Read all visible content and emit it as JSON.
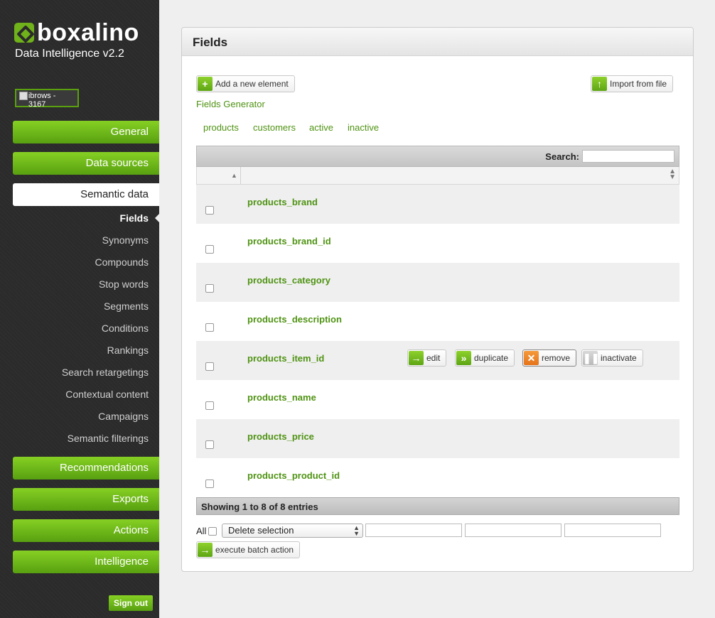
{
  "brand": {
    "name": "boxalino",
    "subtitle": "Data Intelligence v2.2",
    "account": "ibrows - 3167"
  },
  "nav": {
    "general": "General",
    "data_sources": "Data sources",
    "semantic_data": "Semantic data",
    "sub_items": [
      "Fields",
      "Synonyms",
      "Compounds",
      "Stop words",
      "Segments",
      "Conditions",
      "Rankings",
      "Search retargetings",
      "Contextual content",
      "Campaigns",
      "Semantic filterings"
    ],
    "recommendations": "Recommendations",
    "exports": "Exports",
    "actions": "Actions",
    "intelligence": "Intelligence",
    "sign_out": "Sign out"
  },
  "panel": {
    "title": "Fields",
    "add_button": "Add a new element",
    "import_button": "Import from file",
    "generator_link": "Fields Generator",
    "filters": [
      "products",
      "customers",
      "active",
      "inactive"
    ],
    "search_label": "Search:",
    "rows": [
      "products_brand",
      "products_brand_id",
      "products_category",
      "products_description",
      "products_item_id",
      "products_name",
      "products_price",
      "products_product_id"
    ],
    "row_actions": {
      "edit": "edit",
      "duplicate": "duplicate",
      "remove": "remove",
      "inactivate": "inactivate"
    },
    "footer": "Showing 1 to 8 of 8 entries",
    "batch": {
      "all_label": "All",
      "selected_action": "Delete selection",
      "execute_button": "execute batch action"
    }
  },
  "colors": {
    "accent": "#6fb21a",
    "link": "#4f9313",
    "sidebar": "#2b2b2b"
  }
}
